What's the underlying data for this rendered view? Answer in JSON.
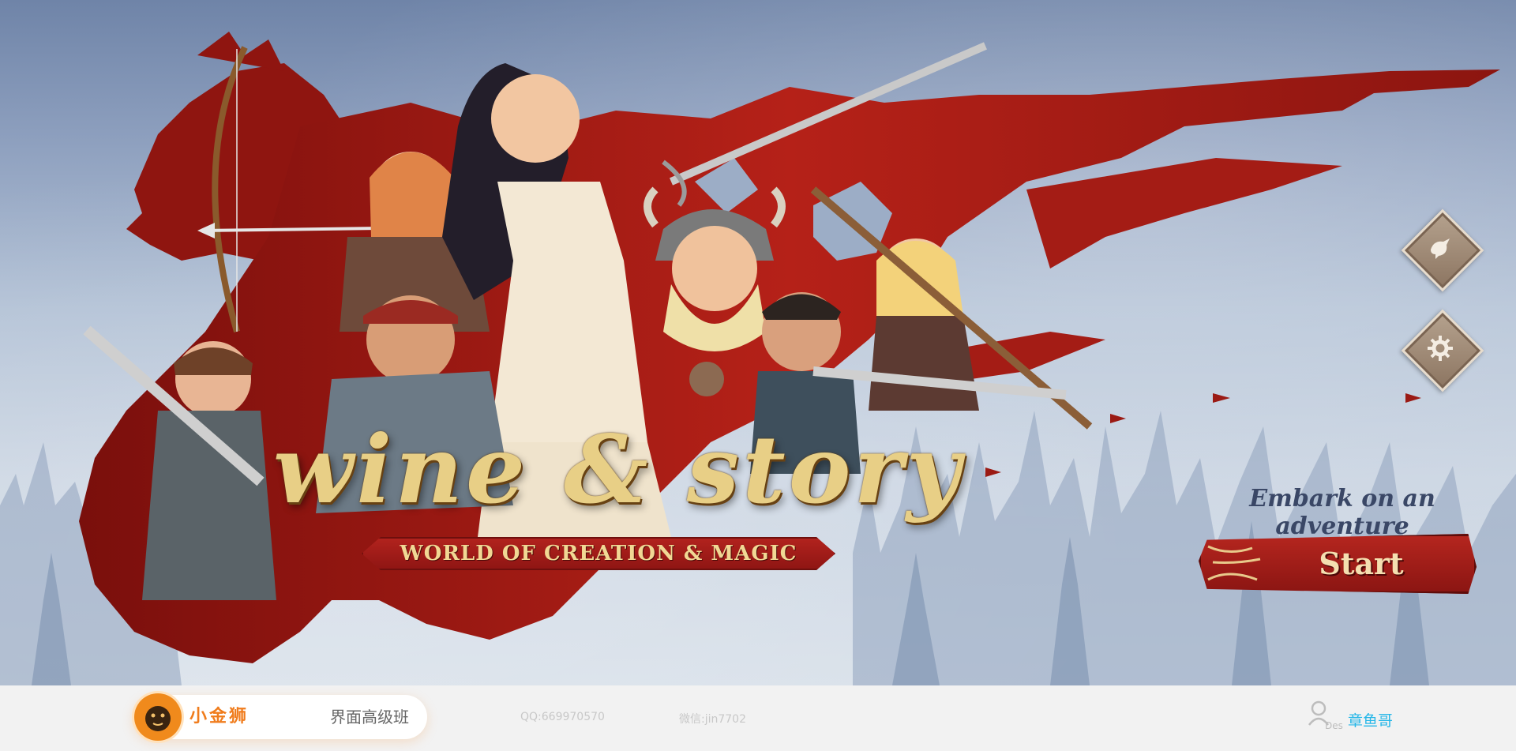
{
  "hero": {
    "logo_title": "wine & story",
    "logo_subtitle": "WORLD OF CREATION & MAGIC",
    "embark_text": "Embark on an adventure",
    "start_label": "Start",
    "side_buttons": [
      {
        "name": "bird-icon"
      },
      {
        "name": "gear-icon"
      }
    ],
    "colors": {
      "banner_red": "#9b1a14",
      "gold": "#e8cf86",
      "sky_top": "#6f84a8",
      "sky_bottom": "#d9e1ea"
    }
  },
  "footer": {
    "brand_name": "小金狮",
    "brand_class": "界面高级班",
    "qq": "QQ:669970570",
    "wechat": "微信:jin7702",
    "user_sub": "Des",
    "user_name": "章鱼哥",
    "colors": {
      "brand_orange": "#f07c1c",
      "user_blue": "#25b7e8"
    }
  }
}
